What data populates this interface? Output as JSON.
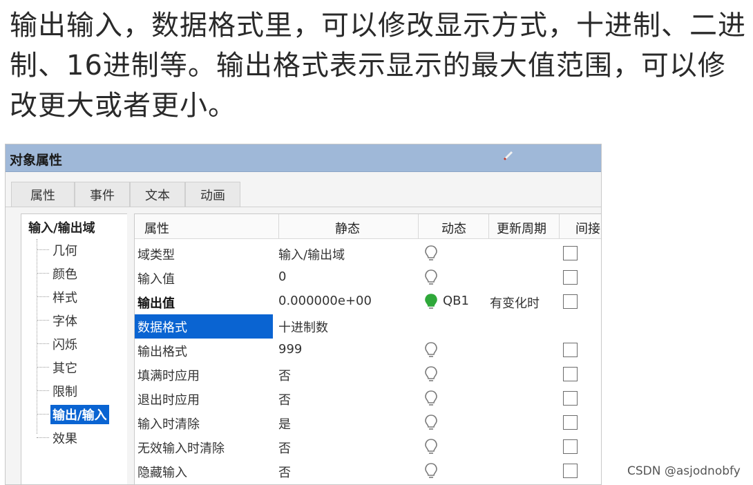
{
  "caption": "输出输入，数据格式里，可以修改显示方式，十进制、二进制、16进制等。输出格式表示显示的最大值范围，可以修改更大或者更小。",
  "window": {
    "title": "对象属性"
  },
  "tabs": [
    {
      "label": "属性",
      "active": true
    },
    {
      "label": "事件",
      "active": false
    },
    {
      "label": "文本",
      "active": false
    },
    {
      "label": "动画",
      "active": false
    }
  ],
  "tree": {
    "root": "输入/输出域",
    "items": [
      {
        "label": "几何",
        "selected": false
      },
      {
        "label": "颜色",
        "selected": false
      },
      {
        "label": "样式",
        "selected": false
      },
      {
        "label": "字体",
        "selected": false
      },
      {
        "label": "闪烁",
        "selected": false
      },
      {
        "label": "其它",
        "selected": false
      },
      {
        "label": "限制",
        "selected": false
      },
      {
        "label": "输出/输入",
        "selected": true
      },
      {
        "label": "效果",
        "selected": false
      }
    ]
  },
  "grid": {
    "headers": {
      "property": "属性",
      "static": "静态",
      "dynamic": "动态",
      "cycle": "更新周期",
      "indirect": "间接"
    },
    "rows": [
      {
        "name": "域类型",
        "static": "输入/输出域",
        "bulb": "off",
        "dynamic": "",
        "cycle": "",
        "checkbox": true,
        "bold": false,
        "selected": false
      },
      {
        "name": "输入值",
        "static": "0",
        "bulb": "off",
        "dynamic": "",
        "cycle": "",
        "checkbox": true,
        "bold": false,
        "selected": false
      },
      {
        "name": "输出值",
        "static": "0.000000e+00",
        "bulb": "on",
        "dynamic": "QB1",
        "cycle": "有变化时",
        "checkbox": true,
        "bold": true,
        "selected": false
      },
      {
        "name": "数据格式",
        "static": "十进制数",
        "bulb": "none",
        "dynamic": "",
        "cycle": "",
        "checkbox": false,
        "bold": false,
        "selected": true
      },
      {
        "name": "输出格式",
        "static": "999",
        "bulb": "off",
        "dynamic": "",
        "cycle": "",
        "checkbox": true,
        "bold": false,
        "selected": false
      },
      {
        "name": "填满时应用",
        "static": "否",
        "bulb": "off",
        "dynamic": "",
        "cycle": "",
        "checkbox": true,
        "bold": false,
        "selected": false
      },
      {
        "name": "退出时应用",
        "static": "否",
        "bulb": "off",
        "dynamic": "",
        "cycle": "",
        "checkbox": true,
        "bold": false,
        "selected": false
      },
      {
        "name": "输入时清除",
        "static": "是",
        "bulb": "off",
        "dynamic": "",
        "cycle": "",
        "checkbox": true,
        "bold": false,
        "selected": false
      },
      {
        "name": "无效输入时清除",
        "static": "否",
        "bulb": "off",
        "dynamic": "",
        "cycle": "",
        "checkbox": true,
        "bold": false,
        "selected": false
      },
      {
        "name": "隐藏输入",
        "static": "否",
        "bulb": "off",
        "dynamic": "",
        "cycle": "",
        "checkbox": true,
        "bold": false,
        "selected": false
      }
    ]
  },
  "colors": {
    "selection": "#0a64d2",
    "titlebar": "#9fb8d8",
    "bulb_on": "#2fa83a",
    "bulb_off": "#7a7a7a"
  },
  "watermark": "CSDN @asjodnobfy"
}
